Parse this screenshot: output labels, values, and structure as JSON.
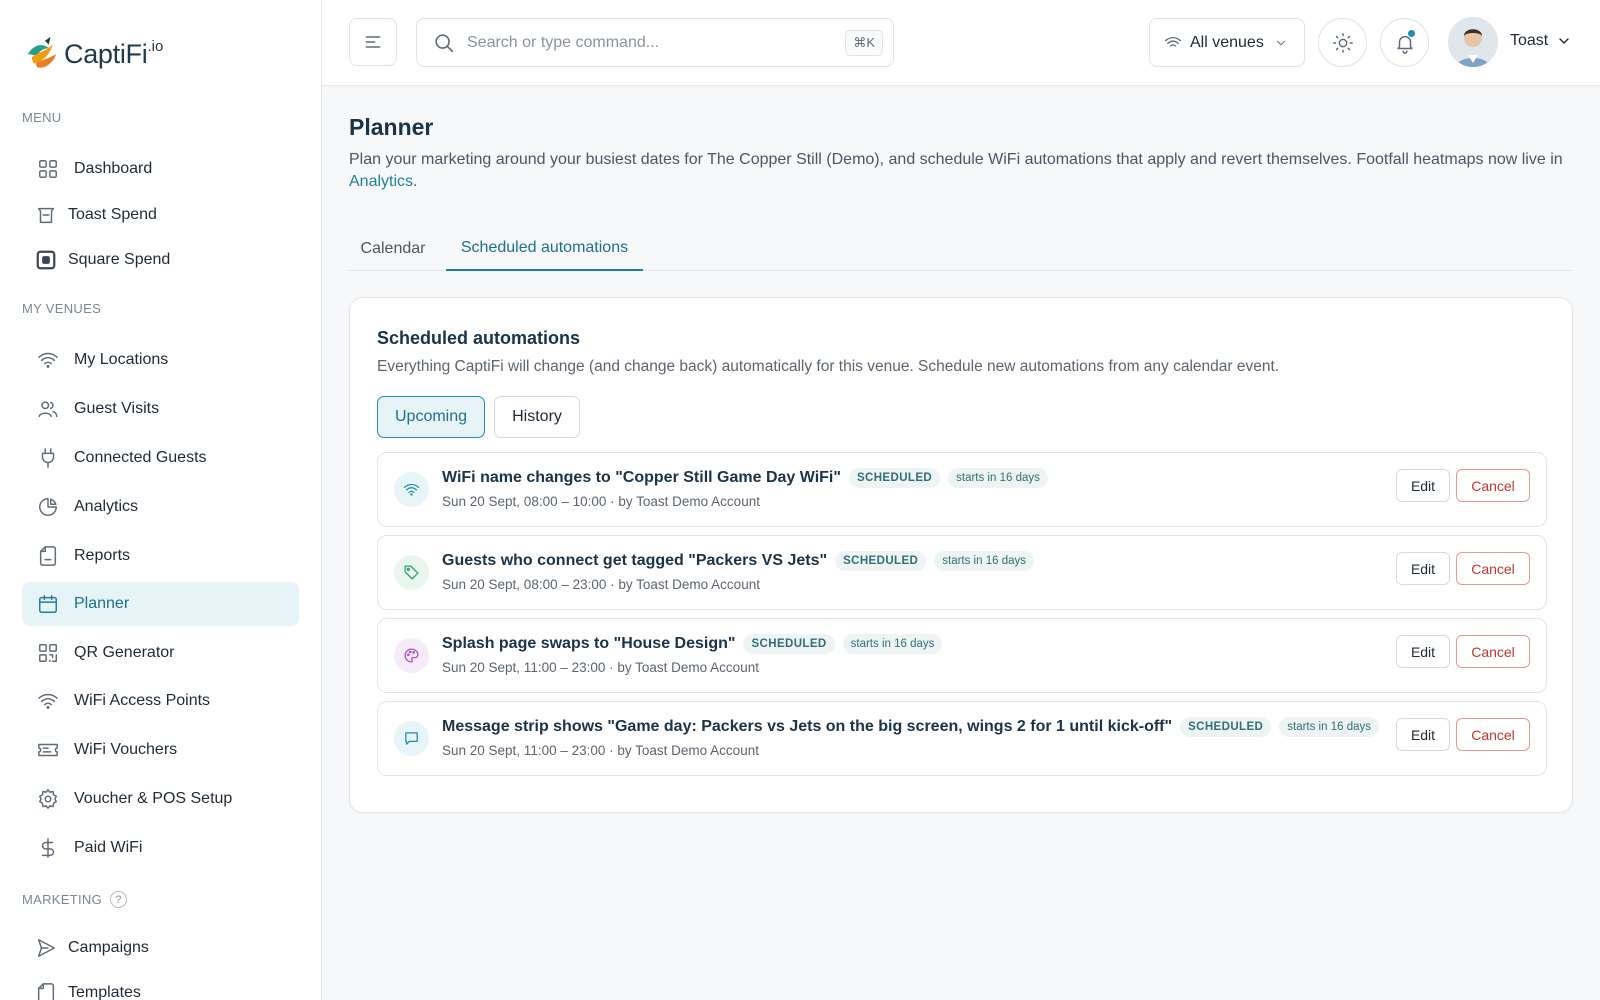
{
  "brand": {
    "name": "CaptiFi",
    "suffix": ".io"
  },
  "sidebar": {
    "sections": {
      "menu": "MENU",
      "venues": "MY VENUES",
      "marketing": "MARKETING",
      "marketing_help": "?"
    },
    "menu_items": [
      {
        "label": "Dashboard",
        "icon": "grid-icon"
      },
      {
        "label": "Toast Spend",
        "icon": "toast-icon"
      },
      {
        "label": "Square Spend",
        "icon": "square-icon"
      }
    ],
    "venue_items": [
      {
        "label": "My Locations",
        "icon": "wifi-icon"
      },
      {
        "label": "Guest Visits",
        "icon": "users-icon"
      },
      {
        "label": "Connected Guests",
        "icon": "plug-icon"
      },
      {
        "label": "Analytics",
        "icon": "pie-chart-icon"
      },
      {
        "label": "Reports",
        "icon": "document-icon"
      },
      {
        "label": "Planner",
        "icon": "calendar-icon",
        "active": true
      },
      {
        "label": "QR Generator",
        "icon": "qr-icon"
      },
      {
        "label": "WiFi Access Points",
        "icon": "wifi-icon"
      },
      {
        "label": "WiFi Vouchers",
        "icon": "ticket-icon"
      },
      {
        "label": "Voucher & POS Setup",
        "icon": "gear-icon"
      },
      {
        "label": "Paid WiFi",
        "icon": "dollar-icon"
      }
    ],
    "marketing_items": [
      {
        "label": "Campaigns",
        "icon": "send-icon"
      },
      {
        "label": "Templates",
        "icon": "document-icon"
      }
    ]
  },
  "topbar": {
    "search_placeholder": "Search or type command...",
    "search_shortcut": "⌘K",
    "venue_select": "All venues",
    "user_name": "Toast"
  },
  "page": {
    "title": "Planner",
    "description": "Plan your marketing around your busiest dates for The Copper Still (Demo), and schedule WiFi automations that apply and revert themselves. Footfall heatmaps now live in ",
    "description_link": "Analytics",
    "description_end": ".",
    "tabs": [
      {
        "label": "Calendar",
        "active": false
      },
      {
        "label": "Scheduled automations",
        "active": true
      }
    ]
  },
  "automations": {
    "title": "Scheduled automations",
    "description": "Everything CaptiFi will change (and change back) automatically for this venue. Schedule new automations from any calendar event.",
    "filter_upcoming": "Upcoming",
    "filter_history": "History",
    "edit_label": "Edit",
    "cancel_label": "Cancel",
    "items": [
      {
        "title": "WiFi name changes to \"Copper Still Game Day WiFi\"",
        "status": "SCHEDULED",
        "starts": "starts in 16 days",
        "meta": "Sun 20 Sept, 08:00 – 10:00 · by Toast Demo Account",
        "icon": "wifi-icon",
        "color": "#1e8fb0",
        "bg": "#e8f5f8"
      },
      {
        "title": "Guests who connect get tagged \"Packers VS Jets\"",
        "status": "SCHEDULED",
        "starts": "starts in 16 days",
        "meta": "Sun 20 Sept, 08:00 – 23:00 · by Toast Demo Account",
        "icon": "tag-icon",
        "color": "#2e9e6a",
        "bg": "#e9f6ef"
      },
      {
        "title": "Splash page swaps to \"House Design\"",
        "status": "SCHEDULED",
        "starts": "starts in 16 days",
        "meta": "Sun 20 Sept, 11:00 – 23:00 · by Toast Demo Account",
        "icon": "palette-icon",
        "color": "#b04fc9",
        "bg": "#f6ebf8"
      },
      {
        "title": "Message strip shows \"Game day: Packers vs Jets on the big screen, wings 2 for 1 until kick-off\"",
        "status": "SCHEDULED",
        "starts": "starts in 16 days",
        "meta": "Sun 20 Sept, 11:00 – 23:00 · by Toast Demo Account",
        "icon": "message-icon",
        "color": "#1e8fb0",
        "bg": "#e8f5f8"
      }
    ]
  }
}
